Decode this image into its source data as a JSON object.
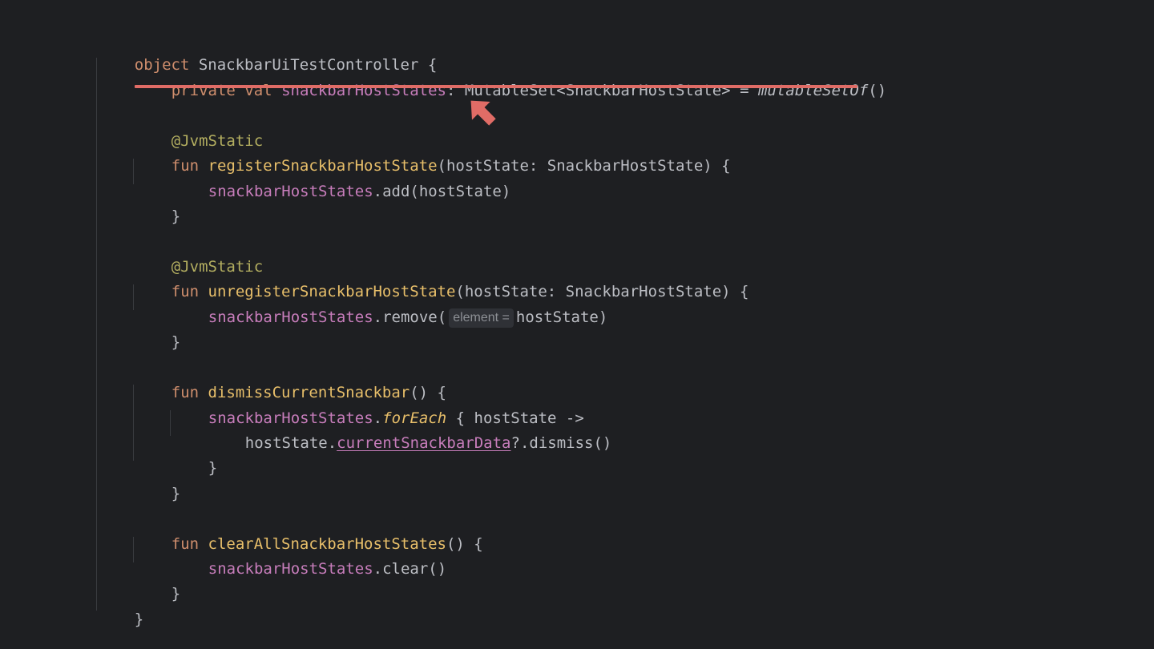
{
  "code": {
    "l1": {
      "kw": "object",
      "name": "SnackbarUiTestController",
      "brace": "{"
    },
    "l2": {
      "kw1": "private",
      "kw2": "val",
      "prop": "snackbarHostStates",
      "colon": ":",
      "type": "MutableSet<SnackbarHostState>",
      "eq": "=",
      "call": "mutableSetOf",
      "parens": "()"
    },
    "l3": {
      "ann": "@JvmStatic"
    },
    "l4": {
      "kw": "fun",
      "name": "registerSnackbarHostState",
      "params": "(hostState: SnackbarHostState) {"
    },
    "l5": {
      "prop": "snackbarHostStates",
      "rest": ".add(hostState)"
    },
    "l6": {
      "brace": "}"
    },
    "l7": {
      "ann": "@JvmStatic"
    },
    "l8": {
      "kw": "fun",
      "name": "unregisterSnackbarHostState",
      "params": "(hostState: SnackbarHostState) {"
    },
    "l9": {
      "prop": "snackbarHostStates",
      "call": ".remove(",
      "hint": "element =",
      "rest": "hostState)"
    },
    "l10": {
      "brace": "}"
    },
    "l11": {
      "kw": "fun",
      "name": "dismissCurrentSnackbar",
      "params": "() {"
    },
    "l12": {
      "prop": "snackbarHostStates",
      "dot": ".",
      "ext": "forEach",
      "rest": " { hostState ->"
    },
    "l13": {
      "pre": "hostState.",
      "link": "currentSnackbarData",
      "rest": "?.dismiss()"
    },
    "l14": {
      "brace": "}"
    },
    "l15": {
      "brace": "}"
    },
    "l16": {
      "kw": "fun",
      "name": "clearAllSnackbarHostStates",
      "params": "() {"
    },
    "l17": {
      "prop": "snackbarHostStates",
      "rest": ".clear()"
    },
    "l18": {
      "brace": "}"
    },
    "l19": {
      "brace": "}"
    }
  },
  "colors": {
    "background": "#1e1f22",
    "keyword": "#cf8e6d",
    "property": "#c77dbb",
    "function": "#e8bf6a",
    "annotation": "#b3ae60",
    "highlight_underline": "#e06c66",
    "arrow": "#e06c66"
  },
  "icons": {
    "pointer": "arrow-pointer-icon"
  }
}
